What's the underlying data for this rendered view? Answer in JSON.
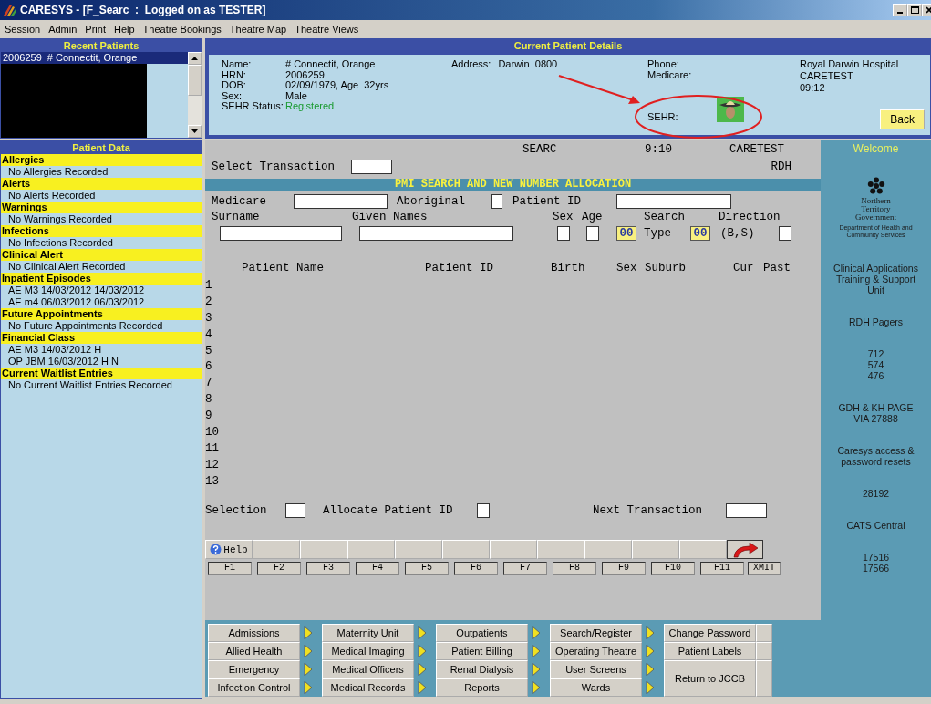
{
  "window": {
    "title": "CARESYS - [F_Searc  :  Logged on as TESTER]"
  },
  "menu": [
    "Session",
    "Admin",
    "Print",
    "Help",
    "Theatre Bookings",
    "Theatre Map",
    "Theatre Views"
  ],
  "recent_patients": {
    "title": "Recent Patients",
    "items": [
      {
        "hrn": "2006259",
        "name": "# Connectit, Orange",
        "selected": true
      }
    ]
  },
  "details": {
    "title": "Current Patient Details",
    "fields": [
      {
        "label": "Name:",
        "value": "# Connectit, Orange",
        "kind": "text"
      },
      {
        "label": "HRN:",
        "value": "2006259",
        "kind": "text"
      },
      {
        "label": "DOB:",
        "value": "02/09/1979, Age  32yrs",
        "kind": "text"
      },
      {
        "label": "Sex:",
        "value": "Male",
        "kind": "text"
      },
      {
        "label": "SEHR Status:",
        "value": "Registered",
        "kind": "status"
      }
    ],
    "address_label": "Address:",
    "address": "Darwin  0800",
    "phone_label": "Phone:",
    "medicare_label": "Medicare:",
    "sehr_label": "SEHR:",
    "site_lines": [
      "Royal Darwin Hospital",
      "CARETEST",
      "09:12"
    ],
    "back_button": "Back"
  },
  "patient_data": {
    "title": "Patient Data",
    "sections": [
      {
        "heading": "Allergies",
        "entries": [
          "No Allergies Recorded"
        ]
      },
      {
        "heading": "Alerts",
        "entries": [
          "No Alerts Recorded"
        ]
      },
      {
        "heading": "Warnings",
        "entries": [
          "No Warnings Recorded"
        ]
      },
      {
        "heading": "Infections",
        "entries": [
          "No Infections Recorded"
        ]
      },
      {
        "heading": "Clinical Alert",
        "entries": [
          "No Clinical Alert Recorded"
        ]
      },
      {
        "heading": "Inpatient Episodes",
        "entries": [
          "AE M3 14/03/2012 14/03/2012",
          "AE m4 06/03/2012 06/03/2012"
        ]
      },
      {
        "heading": "Future Appointments",
        "entries": [
          "No Future Appointments Recorded"
        ]
      },
      {
        "heading": "Financial Class",
        "entries": [
          "AE M3 14/03/2012 H",
          "OP JBM 16/03/2012 H   N"
        ]
      },
      {
        "heading": "Current Waitlist Entries",
        "entries": [
          "No Current Waitlist Entries Recorded"
        ]
      }
    ]
  },
  "terminal": {
    "screen_code": "SEARC",
    "time": "9:10",
    "user": "CARETEST",
    "site": "RDH",
    "transaction_label": "Select Transaction",
    "banner": "PMI SEARCH AND NEW NUMBER ALLOCATION",
    "medicare_label": "Medicare",
    "aboriginal_label": "Aboriginal",
    "patient_id_label": "Patient ID",
    "surname_label": "Surname",
    "given_names_label": "Given Names",
    "sex_label": "Sex",
    "age_label": "Age",
    "search_label": "Search",
    "direction_label": "Direction",
    "search_code": "00",
    "type_label": "Type",
    "type_code": "00",
    "direction_hint": "(B,S)",
    "columns": [
      "Patient Name",
      "Patient ID",
      "Birth",
      "Sex",
      "Suburb",
      "Cur",
      "Past"
    ],
    "row_numbers": [
      "1",
      "2",
      "3",
      "4",
      "5",
      "6",
      "7",
      "8",
      "9",
      "10",
      "11",
      "12",
      "13"
    ],
    "selection_label": "Selection",
    "allocate_label": "Allocate Patient ID",
    "next_label": "Next Transaction"
  },
  "function_keys": [
    {
      "kind": "help",
      "label": "Help",
      "key": "F1"
    },
    {
      "kind": "blank",
      "key": "F2"
    },
    {
      "kind": "blank",
      "key": "F3"
    },
    {
      "kind": "blank",
      "key": "F4"
    },
    {
      "kind": "blank",
      "key": "F5"
    },
    {
      "kind": "blank",
      "key": "F6"
    },
    {
      "kind": "blank",
      "key": "F7"
    },
    {
      "kind": "blank",
      "key": "F8"
    },
    {
      "kind": "blank",
      "key": "F9"
    },
    {
      "kind": "blank",
      "key": "F10"
    },
    {
      "kind": "blank",
      "key": "F11"
    },
    {
      "kind": "transmit",
      "key": "XMIT"
    }
  ],
  "side_panel": {
    "title": "Welcome",
    "logo_lines": [
      "Northern",
      "Territory",
      "Government"
    ],
    "logo_subtitle": "Department of Health and Community Services",
    "blocks": [
      [
        "Clinical Applications",
        "Training & Support",
        "Unit"
      ],
      [
        "RDH Pagers"
      ],
      [
        "712",
        "574",
        "476"
      ],
      [
        "GDH & KH PAGE",
        "VIA 27888"
      ],
      [
        "Caresys access &",
        "password resets"
      ],
      [
        "28192"
      ],
      [
        "CATS Central"
      ],
      [
        "17516",
        "17566"
      ]
    ]
  },
  "navigation": {
    "columns": [
      [
        "Admissions",
        "Allied Health",
        "Emergency",
        "Infection Control"
      ],
      [
        "Maternity Unit",
        "Medical Imaging",
        "Medical Officers",
        "Medical Records"
      ],
      [
        "Outpatients",
        "Patient Billing",
        "Renal Dialysis",
        "Reports"
      ],
      [
        "Search/Register",
        "Operating Theatre",
        "User Screens",
        "Wards"
      ]
    ],
    "extra": [
      {
        "label": "Change Password",
        "kind": "normal"
      },
      {
        "label": "Patient Labels",
        "kind": "normal"
      },
      {
        "label": "Return to JCCB",
        "kind": "tall"
      }
    ]
  }
}
